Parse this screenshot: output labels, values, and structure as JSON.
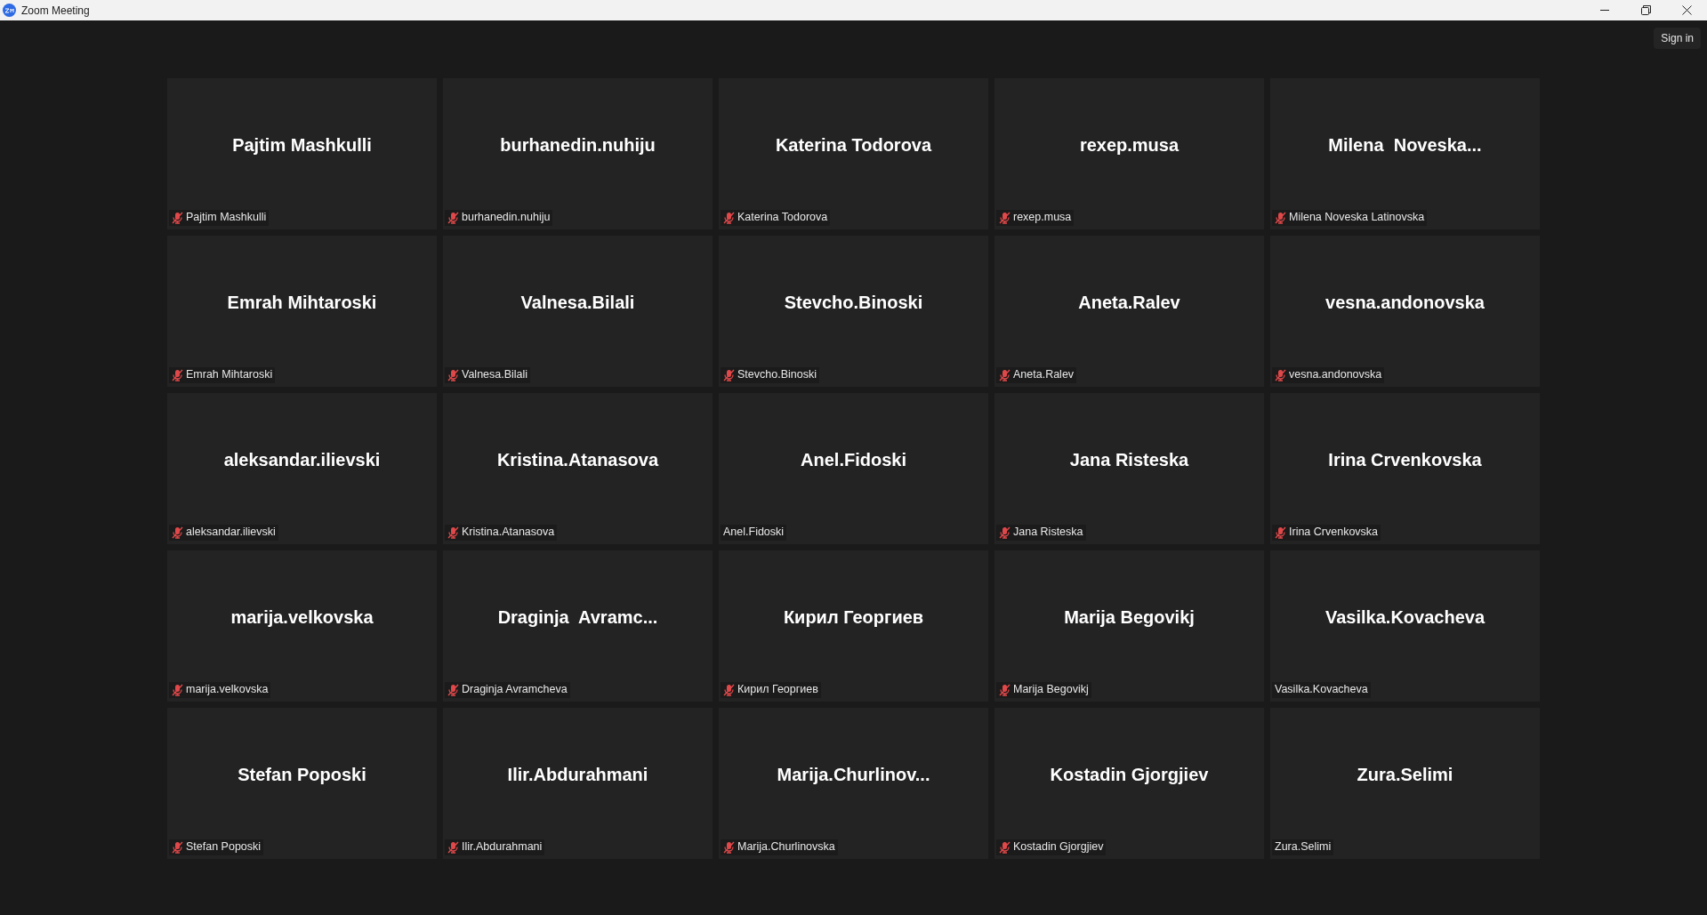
{
  "window": {
    "title": "Zoom Meeting"
  },
  "sign_in": "Sign in",
  "participants": [
    {
      "display": "Pajtim Mashkulli",
      "name": "Pajtim Mashkulli",
      "muted": true
    },
    {
      "display": "burhanedin.nuhiju",
      "name": "burhanedin.nuhiju",
      "muted": true
    },
    {
      "display": "Katerina Todorova",
      "name": "Katerina Todorova",
      "muted": true
    },
    {
      "display": "rexep.musa",
      "name": "rexep.musa",
      "muted": true
    },
    {
      "display": "Milena  Noveska...",
      "name": "Milena Noveska Latinovska",
      "muted": true
    },
    {
      "display": "Emrah Mihtaroski",
      "name": "Emrah Mihtaroski",
      "muted": true
    },
    {
      "display": "Valnesa.Bilali",
      "name": "Valnesa.Bilali",
      "muted": true
    },
    {
      "display": "Stevcho.Binoski",
      "name": "Stevcho.Binoski",
      "muted": true
    },
    {
      "display": "Aneta.Ralev",
      "name": "Aneta.Ralev",
      "muted": true
    },
    {
      "display": "vesna.andonovska",
      "name": "vesna.andonovska",
      "muted": true
    },
    {
      "display": "aleksandar.ilievski",
      "name": "aleksandar.ilievski",
      "muted": true
    },
    {
      "display": "Kristina.Atanasova",
      "name": "Kristina.Atanasova",
      "muted": true
    },
    {
      "display": "Anel.Fidoski",
      "name": "Anel.Fidoski",
      "muted": false
    },
    {
      "display": "Jana Risteska",
      "name": "Jana Risteska",
      "muted": true
    },
    {
      "display": "Irina Crvenkovska",
      "name": "Irina Crvenkovska",
      "muted": true
    },
    {
      "display": "marija.velkovska",
      "name": "marija.velkovska",
      "muted": true
    },
    {
      "display": "Draginja  Avramc...",
      "name": "Draginja Avramcheva",
      "muted": true
    },
    {
      "display": "Кирил Георгиев",
      "name": "Кирил Георгиев",
      "muted": true
    },
    {
      "display": "Marija Begovikj",
      "name": "Marija Begovikj",
      "muted": true
    },
    {
      "display": "Vasilka.Kovacheva",
      "name": "Vasilka.Kovacheva",
      "muted": false
    },
    {
      "display": "Stefan Poposki",
      "name": "Stefan Poposki",
      "muted": true
    },
    {
      "display": "Ilir.Abdurahmani",
      "name": "Ilir.Abdurahmani",
      "muted": true
    },
    {
      "display": "Marija.Churlinov...",
      "name": "Marija.Churlinovska",
      "muted": true
    },
    {
      "display": "Kostadin Gjorgjiev",
      "name": "Kostadin Gjorgjiev",
      "muted": true
    },
    {
      "display": "Zura.Selimi",
      "name": "Zura.Selimi",
      "muted": false
    }
  ]
}
